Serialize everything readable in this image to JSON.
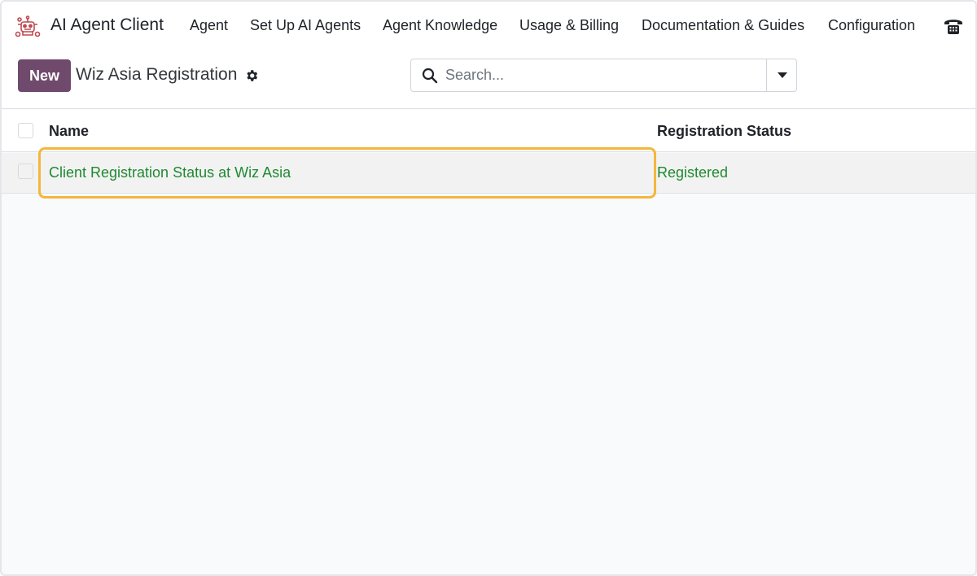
{
  "app": {
    "name": "AI Agent Client",
    "logo_icon": "robot-logo-icon"
  },
  "menu": [
    {
      "label": "Agent"
    },
    {
      "label": "Set Up AI Agents"
    },
    {
      "label": "Agent Knowledge"
    },
    {
      "label": "Usage & Billing"
    },
    {
      "label": "Documentation & Guides"
    },
    {
      "label": "Configuration"
    }
  ],
  "systray": {
    "phone_icon": "phone-icon"
  },
  "control": {
    "new_label": "New",
    "breadcrumb": "Wiz Asia Registration",
    "gear_icon": "gear-icon"
  },
  "search": {
    "placeholder": "Search...",
    "value": "",
    "toggle_icon": "caret-down-icon"
  },
  "list": {
    "columns": [
      "Name",
      "Registration Status"
    ],
    "rows": [
      {
        "name": "Client Registration Status at Wiz Asia",
        "status": "Registered"
      }
    ]
  },
  "colors": {
    "primary": "#6f4a6d",
    "link_green": "#1e8a2f",
    "highlight": "#f5b63c"
  }
}
